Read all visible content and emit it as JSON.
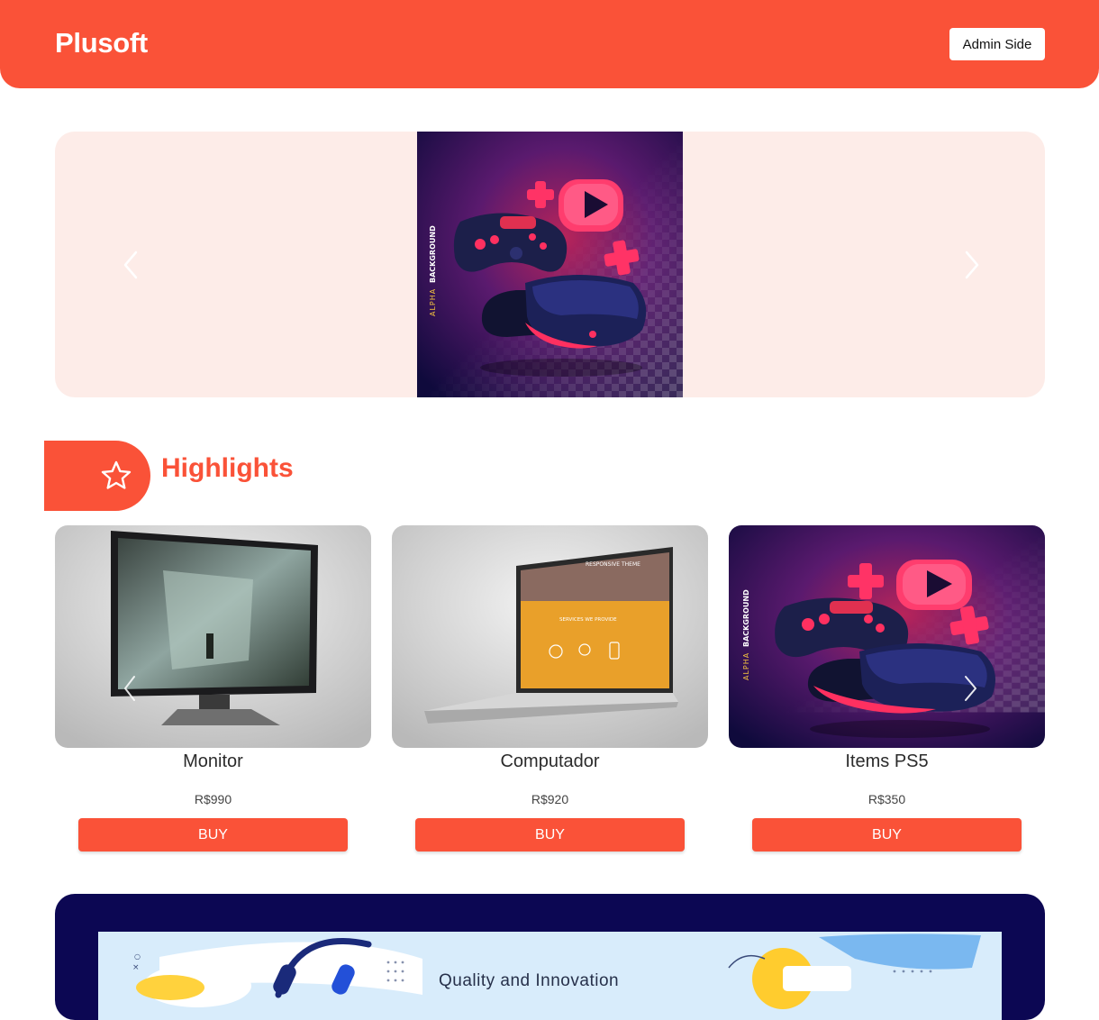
{
  "header": {
    "logo": "Plusoft",
    "admin_button": "Admin Side"
  },
  "carousel": {
    "slide_vertical_text_a": "ALPHA",
    "slide_vertical_text_b": "BACKGROUND"
  },
  "highlights": {
    "title": "Highlights",
    "products": [
      {
        "name": "Monitor",
        "price": "R$990",
        "buy_label": "BUY"
      },
      {
        "name": "Computador",
        "price": "R$920",
        "buy_label": "BUY"
      },
      {
        "name": "Items PS5",
        "price": "R$350",
        "buy_label": "BUY"
      }
    ],
    "laptop_screen": {
      "theme": "RESPONSIVE THEME",
      "services": "SERVICES WE PROVIDE"
    }
  },
  "banner": {
    "text": "Quality and Innovation"
  },
  "colors": {
    "accent": "#fa5238",
    "carousel_bg": "#fdece8",
    "banner_bg": "#0c0753"
  },
  "icons": {
    "highlights": "star-icon",
    "prev": "chevron-left-icon",
    "next": "chevron-right-icon"
  }
}
